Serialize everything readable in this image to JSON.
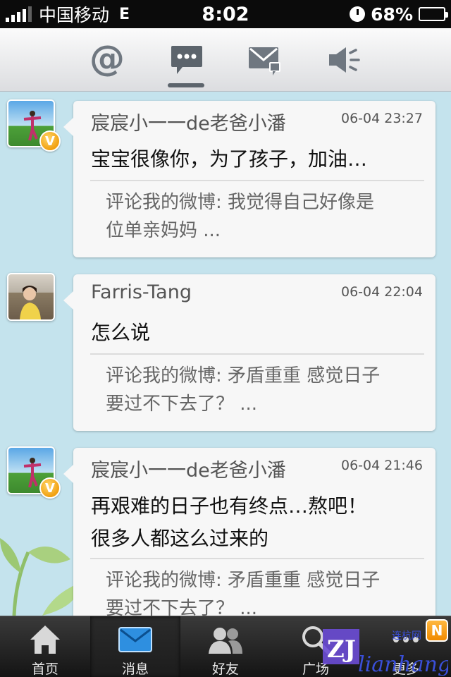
{
  "status_bar": {
    "carrier": "中国移动",
    "network": "E",
    "time": "8:02",
    "battery": "68%",
    "battery_level": 0.68
  },
  "toolbar": {
    "items": [
      {
        "name": "mentions",
        "icon": "at-icon",
        "glyph": "@"
      },
      {
        "name": "comments",
        "icon": "comment-bubble-icon",
        "selected": true
      },
      {
        "name": "direct-messages",
        "icon": "envelope-icon"
      },
      {
        "name": "notifications",
        "icon": "speaker-icon"
      }
    ]
  },
  "messages": [
    {
      "author": "宸宸小一一de老爸小潘",
      "time": "06-04 23:27",
      "verified": true,
      "verified_mark": "V",
      "text": "宝宝很像你，为了孩子，加油…",
      "quote_line1": "评论我的微博: 我觉得自己好像是",
      "quote_line2": "位单亲妈妈 ..."
    },
    {
      "author": "Farris-Tang",
      "time": "06-04 22:04",
      "verified": false,
      "text": "怎么说",
      "quote_line1": "评论我的微博: 矛盾重重 感觉日子",
      "quote_line2": "要过不下去了？ ..."
    },
    {
      "author": "宸宸小一一de老爸小潘",
      "time": "06-04 21:46",
      "verified": true,
      "verified_mark": "V",
      "text_line1": "再艰难的日子也有终点…熬吧！",
      "text_line2": "很多人都这么过来的",
      "quote_line1": "评论我的微博: 矛盾重重 感觉日子",
      "quote_line2": "要过不下去了？ ..."
    }
  ],
  "tabbar": {
    "tabs": [
      {
        "label": "首页",
        "icon": "home-icon"
      },
      {
        "label": "消息",
        "icon": "envelope-icon",
        "active": true
      },
      {
        "label": "好友",
        "icon": "friends-icon"
      },
      {
        "label": "广场",
        "icon": "search-icon"
      },
      {
        "label": "更多",
        "icon": "more-icon",
        "badge": "N"
      }
    ]
  },
  "watermark": {
    "text1": "ZJ",
    "text2": "lianhang",
    "text3": "连杭网"
  },
  "colors": {
    "background": "#c4e3ed",
    "card": "#f7f7f7",
    "toolbar_icon": "#6f7780",
    "tabbar": "#1e1e1e",
    "badge": "#f08a00"
  }
}
